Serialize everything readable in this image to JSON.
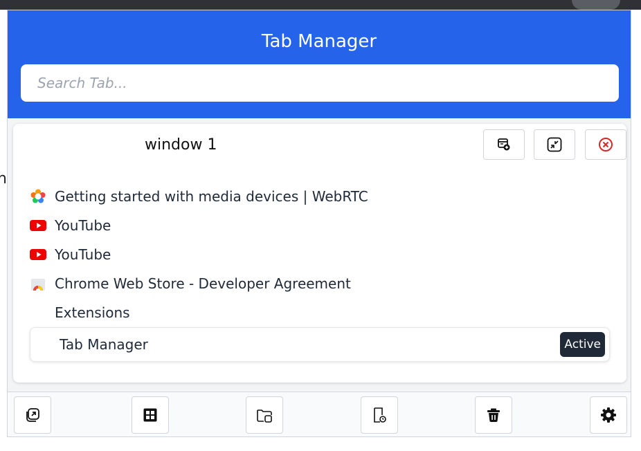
{
  "app": {
    "title": "Tab Manager"
  },
  "search": {
    "placeholder": "Search Tab..."
  },
  "window": {
    "title": "window 1",
    "actions": [
      {
        "name": "new-tab-in-window-button",
        "icon": "browser-plus-icon"
      },
      {
        "name": "collapse-window-button",
        "icon": "minimize-icon"
      },
      {
        "name": "close-window-button",
        "icon": "close-circle-icon",
        "color": "#dc2626"
      }
    ]
  },
  "tabs": [
    {
      "title": "Getting started with media devices  |  WebRTC",
      "icon": "webrtc-icon"
    },
    {
      "title": "YouTube",
      "icon": "youtube-icon"
    },
    {
      "title": "YouTube",
      "icon": "youtube-icon"
    },
    {
      "title": "Chrome Web Store - Developer Agreement",
      "icon": "chrome-web-store-icon"
    },
    {
      "title": "Extensions",
      "icon": "none"
    }
  ],
  "active_tab": {
    "title": "Tab Manager",
    "badge": "Active"
  },
  "behind_page_char": "n",
  "colors": {
    "accent": "#2563eb",
    "badge_bg": "#1f2937",
    "close": "#dc2626"
  }
}
